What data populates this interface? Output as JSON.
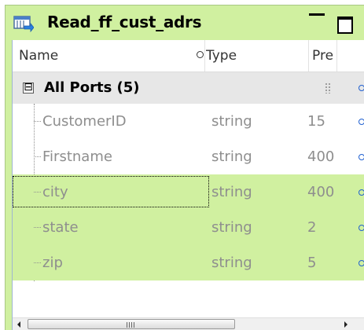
{
  "window": {
    "title": "Read_ff_cust_adrs",
    "title_icon": "flat-file-source-icon"
  },
  "columns": {
    "name": "Name",
    "type": "Type",
    "precision": "Pre"
  },
  "group": {
    "label": "All Ports (5)",
    "expander": "⊟"
  },
  "rows": [
    {
      "name": "CustomerID",
      "type": "string",
      "precision": "15"
    },
    {
      "name": "Firstname",
      "type": "string",
      "precision": "400"
    },
    {
      "name": "city",
      "type": "string",
      "precision": "400"
    },
    {
      "name": "state",
      "type": "string",
      "precision": "2"
    },
    {
      "name": "zip",
      "type": "string",
      "precision": "5"
    }
  ],
  "colors": {
    "selection_green": "#d0f0a0",
    "link_port_blue": "#2060d0"
  }
}
